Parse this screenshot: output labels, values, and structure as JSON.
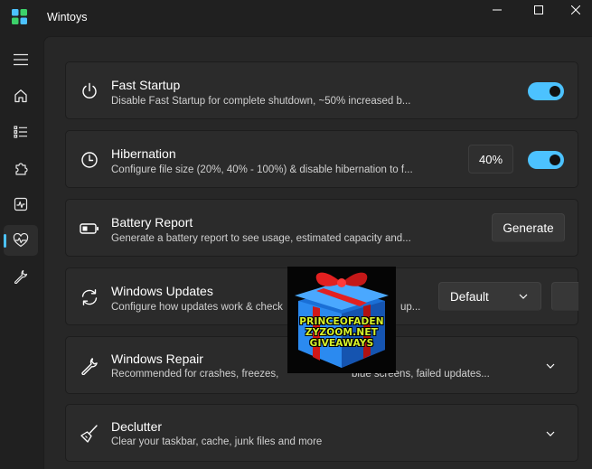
{
  "window": {
    "title": "Wintoys",
    "controls": [
      "minimize-icon",
      "maximize-icon",
      "close-icon"
    ]
  },
  "sidebar": {
    "items": [
      {
        "icon": "hamburger-menu-icon",
        "active": false
      },
      {
        "icon": "home-icon",
        "active": false
      },
      {
        "icon": "list-icon",
        "active": false
      },
      {
        "icon": "puzzle-icon",
        "active": false
      },
      {
        "icon": "activity-monitor-icon",
        "active": false
      },
      {
        "icon": "health-heart-icon",
        "active": true
      },
      {
        "icon": "wrench-icon",
        "active": false
      }
    ]
  },
  "cards": {
    "fast_startup": {
      "title": "Fast Startup",
      "description": "Disable Fast Startup for complete shutdown, ~50% increased b...",
      "toggle_on": true
    },
    "hibernation": {
      "title": "Hibernation",
      "description": "Configure file size (20%, 40% - 100%) & disable hibernation to f...",
      "size_value": "40%",
      "toggle_on": true
    },
    "battery_report": {
      "title": "Battery Report",
      "description": "Generate a battery report to see usage, estimated capacity and...",
      "button_label": "Generate"
    },
    "windows_updates": {
      "title": "Windows Updates",
      "description_left": "Configure how updates work & check",
      "description_right": "up...",
      "dropdown_value": "Default"
    },
    "windows_repair": {
      "title": "Windows Repair",
      "description_left": "Recommended for crashes, freezes,",
      "description_mid": "blue screens, failed updates..."
    },
    "declutter": {
      "title": "Declutter",
      "description": "Clear your taskbar, cache, junk files and more"
    }
  },
  "overlay": {
    "line1": "PRINCEOFADEN",
    "line2": "ZYZOOM.NET",
    "line3": "GIVEAWAYS"
  },
  "colors": {
    "accent": "#4cc2ff",
    "background": "#202020",
    "card": "#2b2b2b",
    "overlay_text": "#d8f32a"
  }
}
